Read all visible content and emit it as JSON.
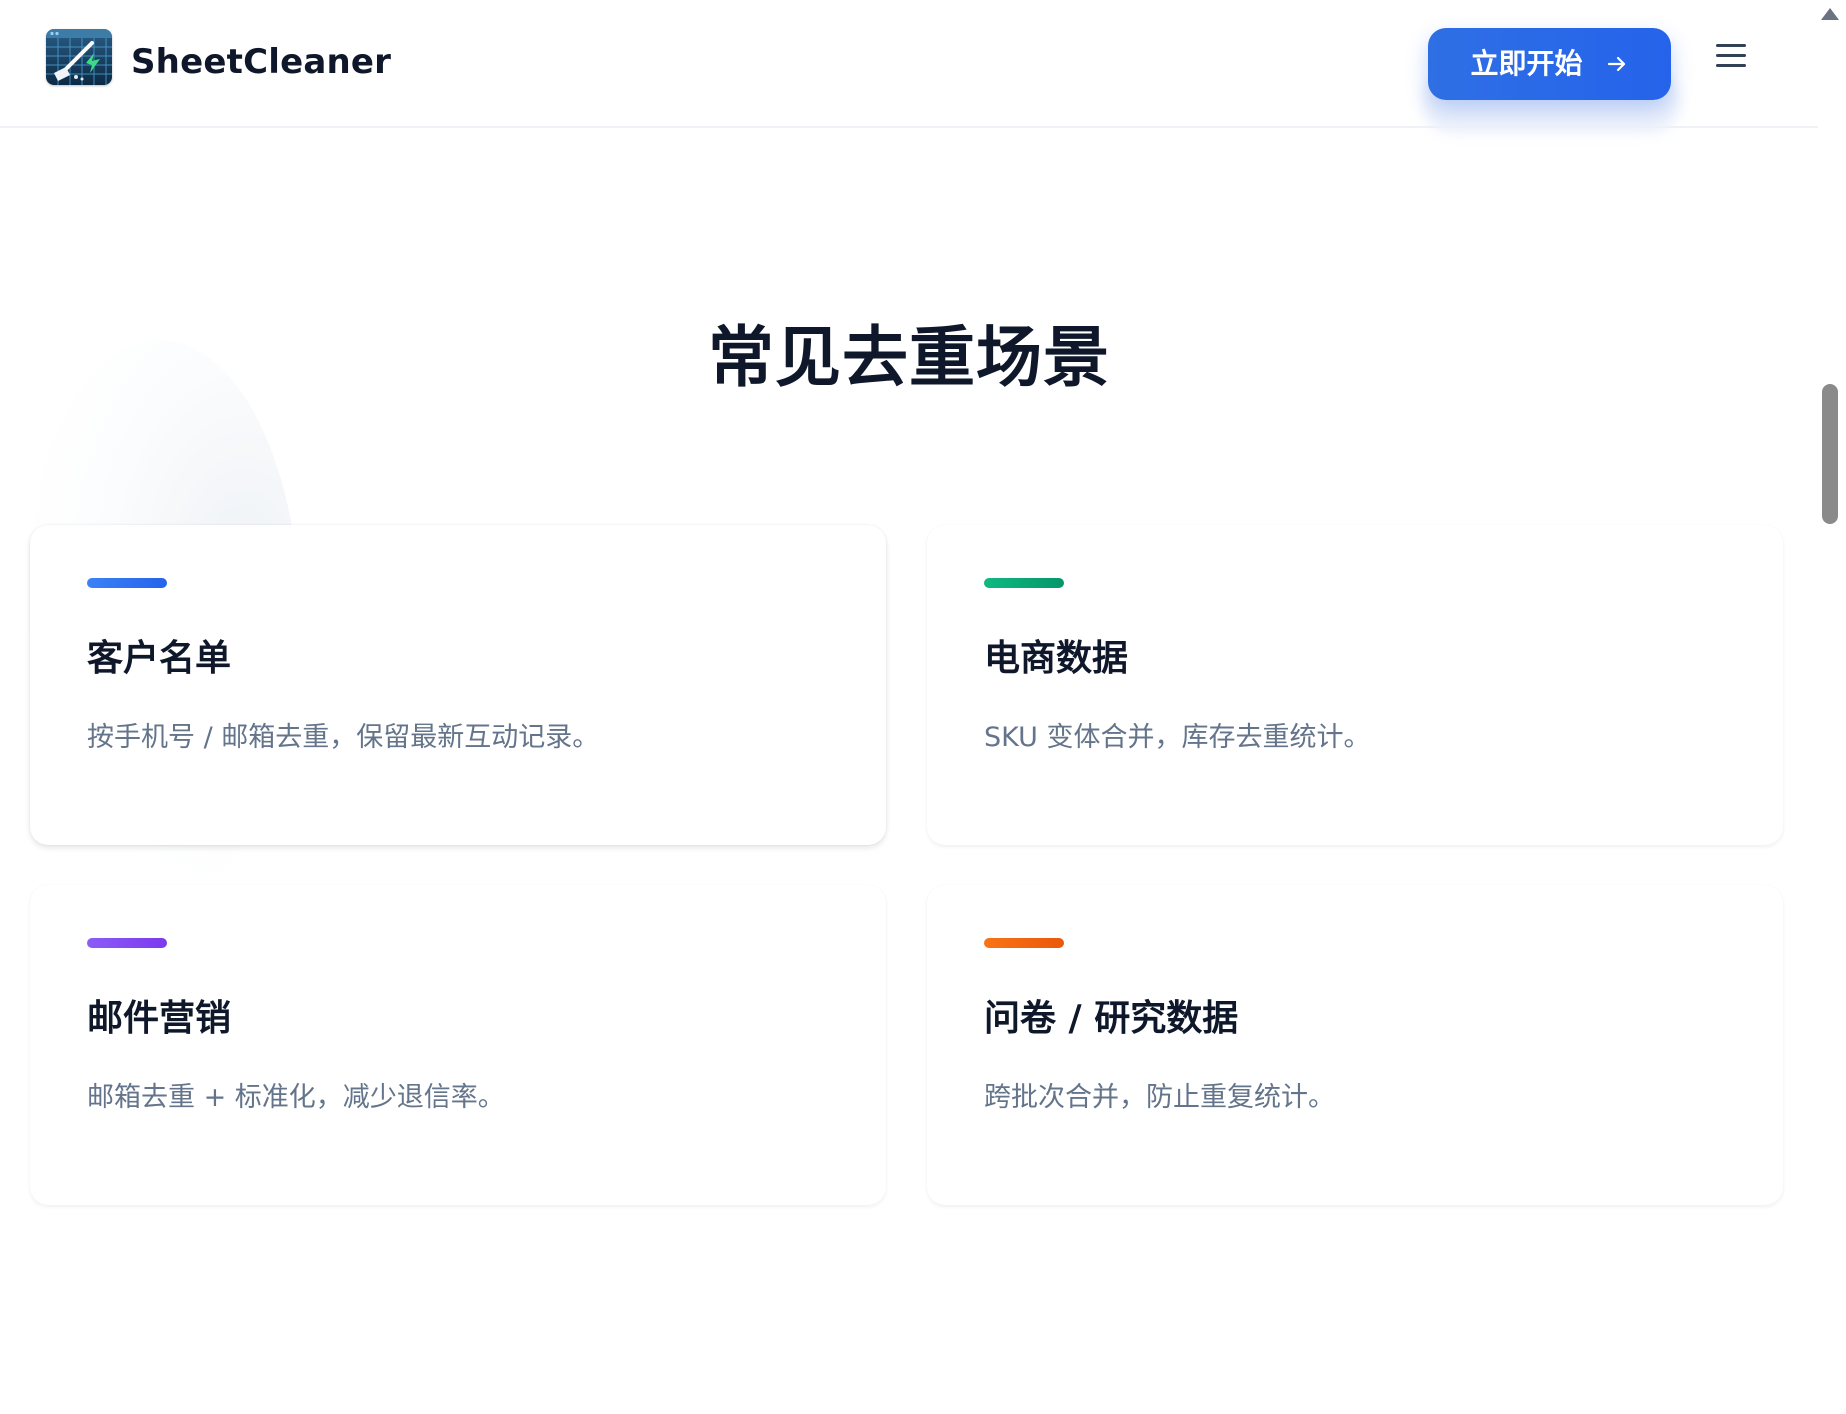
{
  "header": {
    "brand_name": "SheetCleaner",
    "logo_icon": "spreadsheet-cleaning-logo-icon",
    "cta_label": "立即开始",
    "cta_icon": "arrow-right-icon",
    "menu_icon": "hamburger-menu-icon"
  },
  "section": {
    "title": "常见去重场景",
    "cards": [
      {
        "title": "客户名单",
        "description": "按手机号 / 邮箱去重，保留最新互动记录。",
        "accent": "#2563eb"
      },
      {
        "title": "电商数据",
        "description": "SKU 变体合并，库存去重统计。",
        "accent": "#10b981"
      },
      {
        "title": "邮件营销",
        "description": "邮箱去重 + 标准化，减少退信率。",
        "accent": "#8b5cf6"
      },
      {
        "title": "问卷 / 研究数据",
        "description": "跨批次合并，防止重复统计。",
        "accent": "#f97316"
      }
    ]
  },
  "colors": {
    "primary": "#2563eb",
    "heading": "#0f172a",
    "body_text": "#64748b"
  }
}
